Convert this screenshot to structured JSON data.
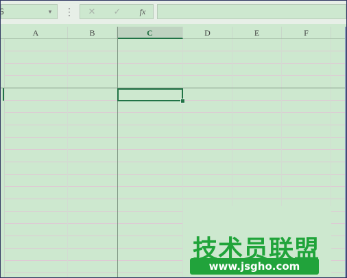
{
  "formula_bar": {
    "name_box_value": "6",
    "dropdown_icon": "▾",
    "separator_icon": "⋮",
    "cancel_icon": "✕",
    "enter_icon": "✓",
    "fx_label": "fx",
    "formula_value": ""
  },
  "grid": {
    "columns": [
      "A",
      "B",
      "C",
      "D",
      "E",
      "F"
    ],
    "selected_column": "C",
    "accent_color": "#217346",
    "background_color": "#cde8cf"
  },
  "watermark": {
    "title": "技术员联盟",
    "url": "www.jsgho.com",
    "color": "#21a33b"
  }
}
